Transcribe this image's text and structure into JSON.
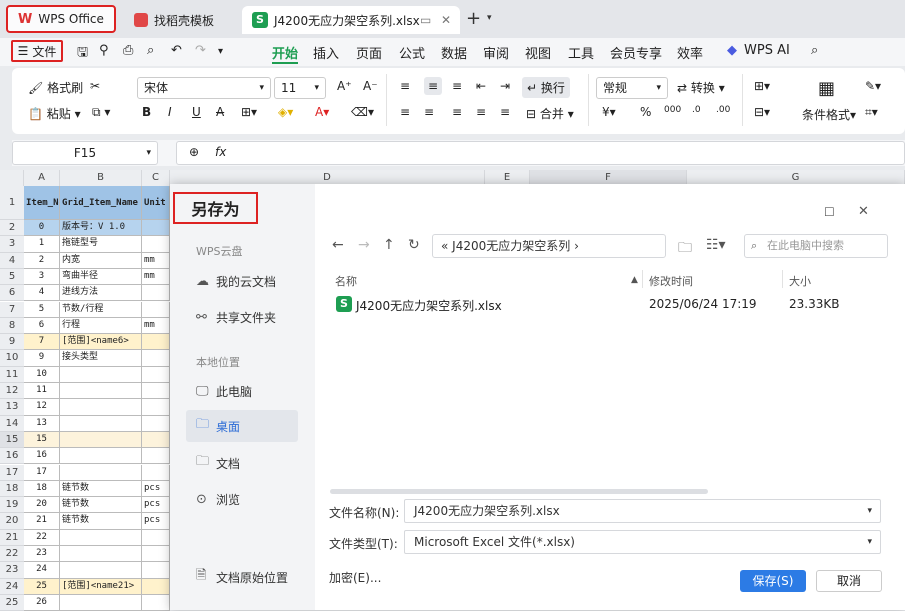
{
  "tabs": [
    {
      "label": "WPS Office",
      "icon": "wps-logo-icon"
    },
    {
      "label": "找稻壳模板",
      "icon": "docer-icon"
    },
    {
      "label": "J4200无应力架空系列.xlsx",
      "icon": "spreadsheet-icon"
    }
  ],
  "menu": {
    "file": "文件",
    "items": [
      "开始",
      "插入",
      "页面",
      "公式",
      "数据",
      "审阅",
      "视图",
      "工具",
      "会员专享",
      "效率"
    ],
    "ai": "WPS AI",
    "active": "开始"
  },
  "ribbon": {
    "format_painter": "格式刷",
    "paste": "粘贴",
    "font_name": "宋体",
    "font_size": "11",
    "wrap": "换行",
    "merge": "合并",
    "number_format": "常规",
    "convert": "转换",
    "cond_format": "条件格式"
  },
  "formula_bar": {
    "cell_ref": "F15",
    "fx": "fx",
    "value": ""
  },
  "columns": [
    "A",
    "B",
    "C",
    "D",
    "E",
    "F",
    "G"
  ],
  "header_row": {
    "a": "Item_No",
    "b": "Grid_Item_Name",
    "c": "Unit"
  },
  "rows": [
    {
      "n": "2",
      "a": "0",
      "b": "版本号：V 1.0",
      "c": ""
    },
    {
      "n": "3",
      "a": "1",
      "b": "拖链型号",
      "c": ""
    },
    {
      "n": "4",
      "a": "2",
      "b": "内宽",
      "c": "mm"
    },
    {
      "n": "5",
      "a": "3",
      "b": "弯曲半径",
      "c": "mm"
    },
    {
      "n": "6",
      "a": "4",
      "b": "进线方法",
      "c": ""
    },
    {
      "n": "7",
      "a": "5",
      "b": "节数/行程",
      "c": ""
    },
    {
      "n": "8",
      "a": "6",
      "b": "行程",
      "c": "mm"
    },
    {
      "n": "9",
      "a": "7",
      "b": "[范围]<name6>",
      "c": ""
    },
    {
      "n": "10",
      "a": "9",
      "b": "接头类型",
      "c": ""
    },
    {
      "n": "11",
      "a": "10",
      "b": "",
      "c": ""
    },
    {
      "n": "12",
      "a": "11",
      "b": "",
      "c": ""
    },
    {
      "n": "13",
      "a": "12",
      "b": "",
      "c": ""
    },
    {
      "n": "14",
      "a": "13",
      "b": "",
      "c": ""
    },
    {
      "n": "15",
      "a": "15",
      "b": "",
      "c": ""
    },
    {
      "n": "16",
      "a": "16",
      "b": "",
      "c": ""
    },
    {
      "n": "17",
      "a": "17",
      "b": "",
      "c": ""
    },
    {
      "n": "18",
      "a": "18",
      "b": "链节数",
      "c": "pcs"
    },
    {
      "n": "19",
      "a": "20",
      "b": "链节数",
      "c": "pcs"
    },
    {
      "n": "20",
      "a": "21",
      "b": "链节数",
      "c": "pcs"
    },
    {
      "n": "21",
      "a": "22",
      "b": "",
      "c": ""
    },
    {
      "n": "22",
      "a": "23",
      "b": "",
      "c": ""
    },
    {
      "n": "23",
      "a": "24",
      "b": "",
      "c": ""
    },
    {
      "n": "24",
      "a": "25",
      "b": "[范围]<name21>",
      "c": ""
    },
    {
      "n": "25",
      "a": "26",
      "b": "",
      "c": ""
    }
  ],
  "dialog": {
    "title": "另存为",
    "cloud_section": "WPS云盘",
    "my_cloud": "我的云文档",
    "shared": "共享文件夹",
    "local_section": "本地位置",
    "this_pc": "此电脑",
    "desktop": "桌面",
    "documents": "文档",
    "browse": "浏览",
    "original_location": "文档原始位置",
    "path": "J4200无应力架空系列",
    "search_placeholder": "在此电脑中搜索",
    "col_name": "名称",
    "col_modified": "修改时间",
    "col_size": "大小",
    "file": {
      "name": "J4200无应力架空系列.xlsx",
      "modified": "2025/06/24 17:19",
      "size": "23.33KB"
    },
    "filename_label": "文件名称(N):",
    "filename_value": "J4200无应力架空系列.xlsx",
    "filetype_label": "文件类型(T):",
    "filetype_value": "Microsoft Excel 文件(*.xlsx)",
    "encrypt": "加密(E)...",
    "save": "保存(S)",
    "cancel": "取消"
  },
  "colors": {
    "accent": "#1e9e52",
    "save_blue": "#2c7be5",
    "highlight_red": "#dd2222",
    "header_blue": "#9fc3e6",
    "row_yellow": "#fff2cc"
  }
}
